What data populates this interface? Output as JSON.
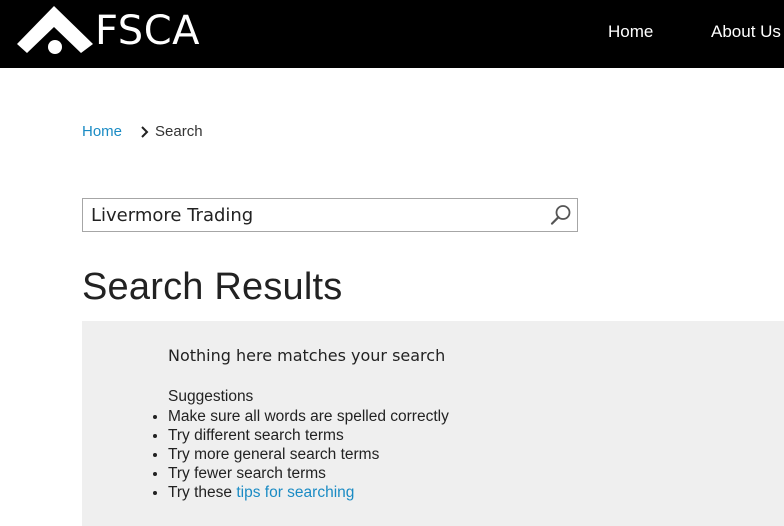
{
  "header": {
    "logo_text": "FSCA",
    "nav": [
      {
        "label": "Home"
      },
      {
        "label": "About Us"
      }
    ]
  },
  "breadcrumb": {
    "home": "Home",
    "current": "Search"
  },
  "search": {
    "value": "Livermore Trading",
    "icon": "search-icon"
  },
  "page_title": "Search Results",
  "results": {
    "message": "Nothing here matches your search",
    "suggestions_heading": "Suggestions",
    "suggestions": [
      "Make sure all words are spelled correctly",
      "Try different search terms",
      "Try more general search terms",
      "Try fewer search terms"
    ],
    "tips_prefix": "Try these",
    "tips_link": "tips for searching"
  },
  "colors": {
    "header_bg": "#000000",
    "link": "#1a8bc4",
    "panel_bg": "#efefef"
  }
}
